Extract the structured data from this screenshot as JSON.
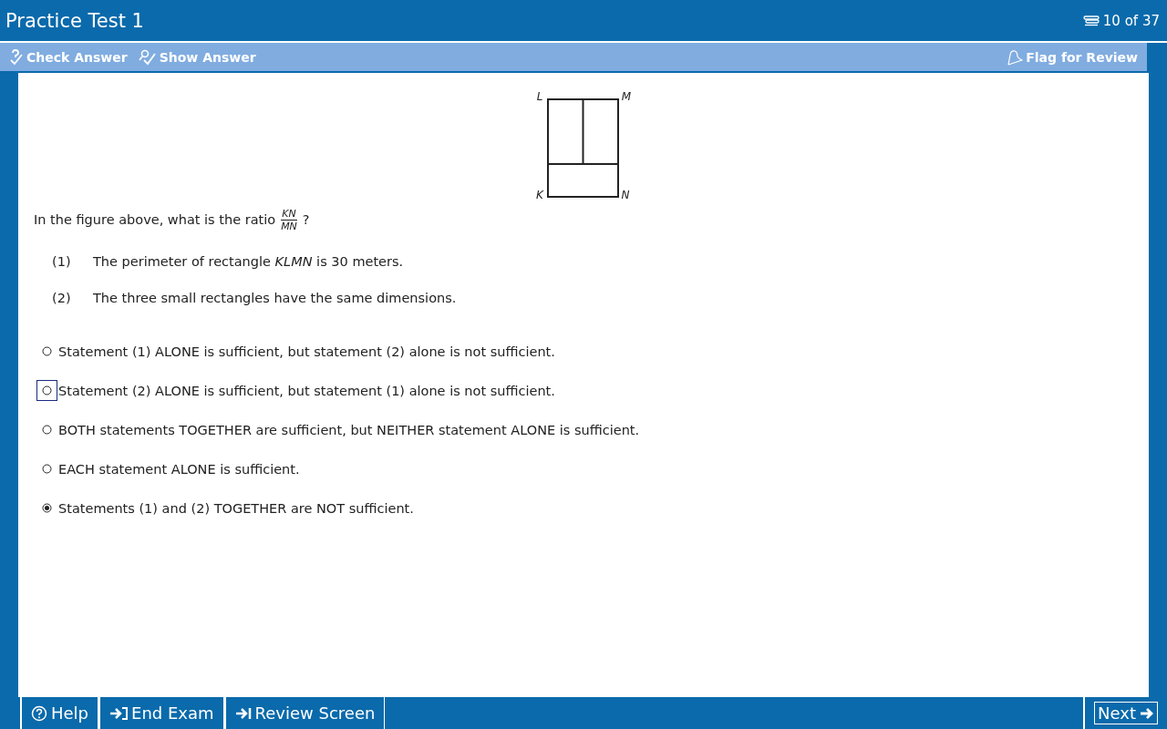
{
  "window": {
    "title": "Practice Test 1"
  },
  "progress": "10 of 37",
  "toolbar": {
    "left": [
      {
        "label": "Check Answer",
        "kind": "check"
      },
      {
        "label": "Show Answer",
        "kind": "show"
      }
    ],
    "flag": {
      "label": "Flag for Review",
      "selected": false
    }
  },
  "figure": {
    "labels": [
      "L",
      "M",
      "K",
      "N"
    ]
  },
  "question": {
    "text": "In the figure above, what is the ratio",
    "numerator": "KN",
    "denominator": "MN",
    "end": "?"
  },
  "statements": [
    {
      "number": "(1)",
      "text": "The perimeter of rectangle *KLMN* is 30 meters."
    },
    {
      "number": "(2)",
      "text": "The three small rectangles have the same dimensions."
    }
  ],
  "options": [
    {
      "label": "Statement (1) ALONE is sufficient, but statement (2) alone is not sufficient.",
      "selected": false,
      "focused": false
    },
    {
      "label": "Statement (2) ALONE is sufficient, but statement (1) alone is not sufficient.",
      "selected": false,
      "focused": true
    },
    {
      "label": "BOTH statements TOGETHER are sufficient, but NEITHER statement ALONE is sufficient.",
      "selected": false,
      "focused": false
    },
    {
      "label": "EACH statement ALONE is sufficient.",
      "selected": false,
      "focused": false
    },
    {
      "label": "Statements (1) and (2) TOGETHER are NOT sufficient.",
      "selected": true,
      "focused": false
    }
  ],
  "footer": {
    "buttons": [
      {
        "label": "Help",
        "kind": "help"
      },
      {
        "label": "End Exam",
        "kind": "end"
      },
      {
        "label": "Review Screen",
        "kind": "review"
      }
    ],
    "next": "Next"
  }
}
